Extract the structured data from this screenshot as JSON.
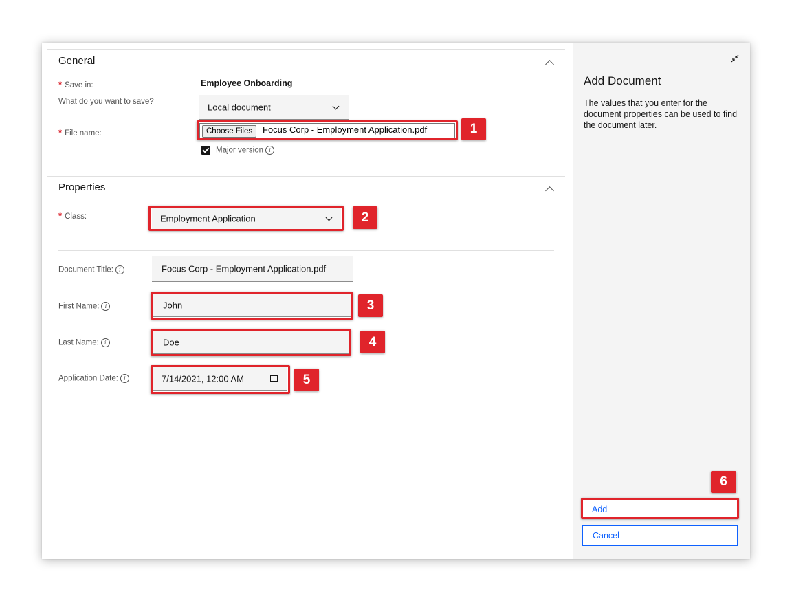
{
  "general": {
    "title": "General",
    "save_in_label": "Save in:",
    "save_in_value": "Employee Onboarding",
    "what_label": "What do you want to save?",
    "what_value": "Local document",
    "file_name_label": "File name:",
    "choose_files_label": "Choose Files",
    "file_name_value": "Focus Corp - Employment Application.pdf",
    "major_version_label": "Major version"
  },
  "properties": {
    "title": "Properties",
    "class_label": "Class:",
    "class_value": "Employment Application",
    "document_title_label": "Document Title:",
    "document_title_value": "Focus Corp - Employment Application.pdf",
    "first_name_label": "First Name:",
    "first_name_value": "John",
    "last_name_label": "Last Name:",
    "last_name_value": "Doe",
    "application_date_label": "Application Date:",
    "application_date_value": "7/14/2021, 12:00 AM"
  },
  "side_panel": {
    "title": "Add Document",
    "description": "The values that you enter for the document properties can be used to find the document later.",
    "add_label": "Add",
    "cancel_label": "Cancel"
  },
  "callouts": [
    "1",
    "2",
    "3",
    "4",
    "5",
    "6"
  ],
  "colors": {
    "callout": "#e0242b",
    "required": "#da1e28",
    "link_blue": "#0f62fe",
    "field_bg": "#f4f4f4",
    "panel_bg": "#f4f4f4"
  },
  "icons": {
    "collapse": "chevron-up-icon",
    "dropdown": "chevron-down-icon",
    "info": "information-icon",
    "calendar": "calendar-icon",
    "minimize": "minimize-icon"
  }
}
